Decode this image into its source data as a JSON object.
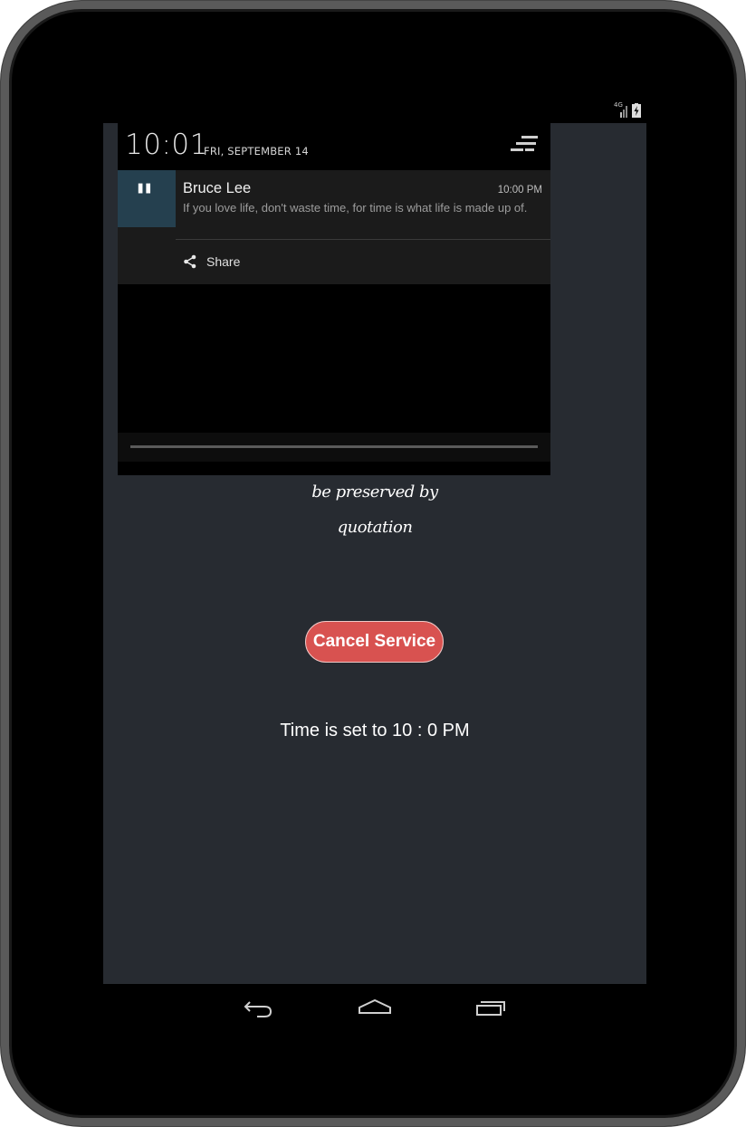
{
  "status_bar": {
    "network_label": "4G",
    "icons": [
      "signal-icon",
      "battery-charging-icon"
    ]
  },
  "notification_shade": {
    "clock": "10:01",
    "date": "FRI, SEPTEMBER 14",
    "clear_icon": "clear-all-icon",
    "notification": {
      "icon": "quote-icon",
      "title": "Bruce Lee",
      "time": "10:00 PM",
      "text": "If you love life, don't waste time, for time is what life is made up of.",
      "action_label": "Share",
      "action_icon": "share-icon"
    }
  },
  "app": {
    "tagline_line1": "be preserved by",
    "tagline_line2": "quotation",
    "cancel_label": "Cancel Service",
    "time_status": "Time is set to 10 : 0 PM",
    "accent_color": "#d85250",
    "background_color": "#272b31"
  },
  "nav_bar": {
    "buttons": [
      "back-icon",
      "home-icon",
      "recents-icon"
    ]
  }
}
